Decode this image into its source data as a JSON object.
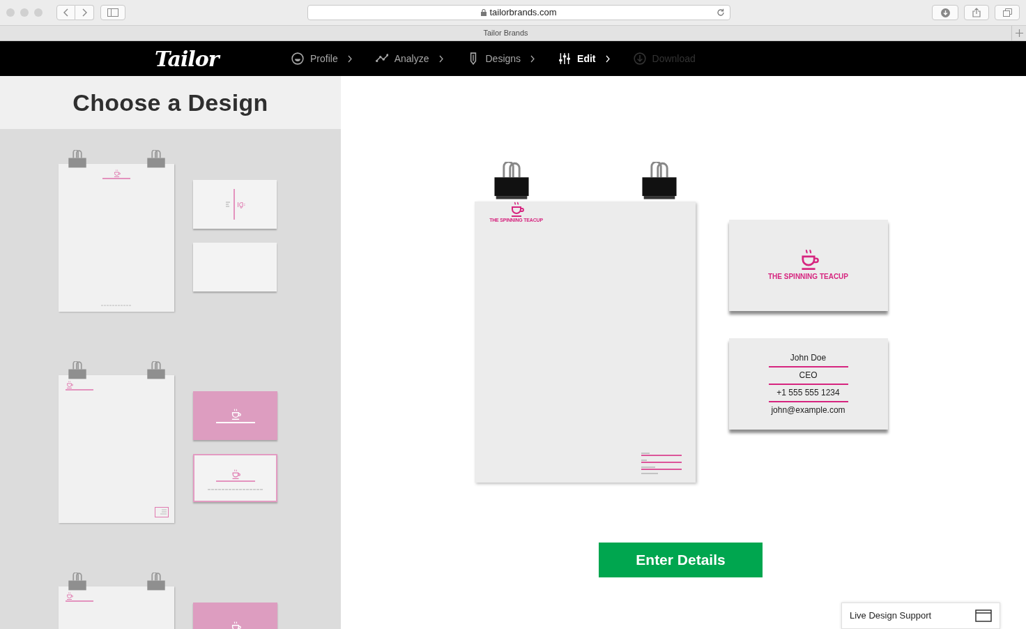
{
  "browser": {
    "url": "tailorbrands.com",
    "tab_title": "Tailor Brands"
  },
  "nav": {
    "logo": "Tailor",
    "steps": [
      {
        "label": "Profile",
        "selected": false,
        "disabled": false
      },
      {
        "label": "Analyze",
        "selected": false,
        "disabled": false
      },
      {
        "label": "Designs",
        "selected": false,
        "disabled": false
      },
      {
        "label": "Edit",
        "selected": true,
        "disabled": false
      },
      {
        "label": "Download",
        "selected": false,
        "disabled": true
      }
    ]
  },
  "sidebar": {
    "title": "Choose a Design",
    "designs": [
      {
        "cards": [
          {
            "kind": "vertical"
          },
          {
            "kind": "blank"
          }
        ]
      },
      {
        "cards": [
          {
            "kind": "pink"
          },
          {
            "kind": "bordered"
          }
        ]
      },
      {
        "cards": [
          {
            "kind": "pink"
          }
        ]
      }
    ]
  },
  "preview": {
    "letterhead_brand": "THE SPINNING TEACUP",
    "card_front_brand": "THE SPINNING TEACUP",
    "card_back_lines": [
      "John Doe",
      "CEO",
      "+1 555 555 1234",
      "john@example.com"
    ]
  },
  "primary_button": "Enter Details",
  "support": {
    "label": "Live Design Support"
  }
}
